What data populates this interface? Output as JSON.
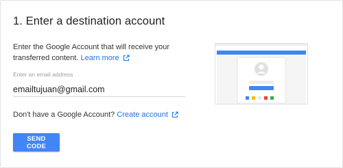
{
  "section": {
    "title": "1. Enter a destination account",
    "description": "Enter the Google Account that will receive your transferred content.",
    "learn_more": "Learn more"
  },
  "email": {
    "label": "Enter an email address",
    "value": "emailtujuan@gmail.com"
  },
  "create": {
    "prompt": "Don't have a Google Account?",
    "link": "Create account"
  },
  "actions": {
    "send_code": "SEND CODE"
  },
  "colors": {
    "accent": "#4285f4",
    "link": "#1a73e8",
    "illustration_dots": [
      "#4285f4",
      "#fbbc04",
      "#e8e8e8",
      "#ea4335",
      "#34a853"
    ]
  },
  "icons": {
    "external": "open-in-new-icon",
    "illustration": "account-browser-illustration"
  }
}
